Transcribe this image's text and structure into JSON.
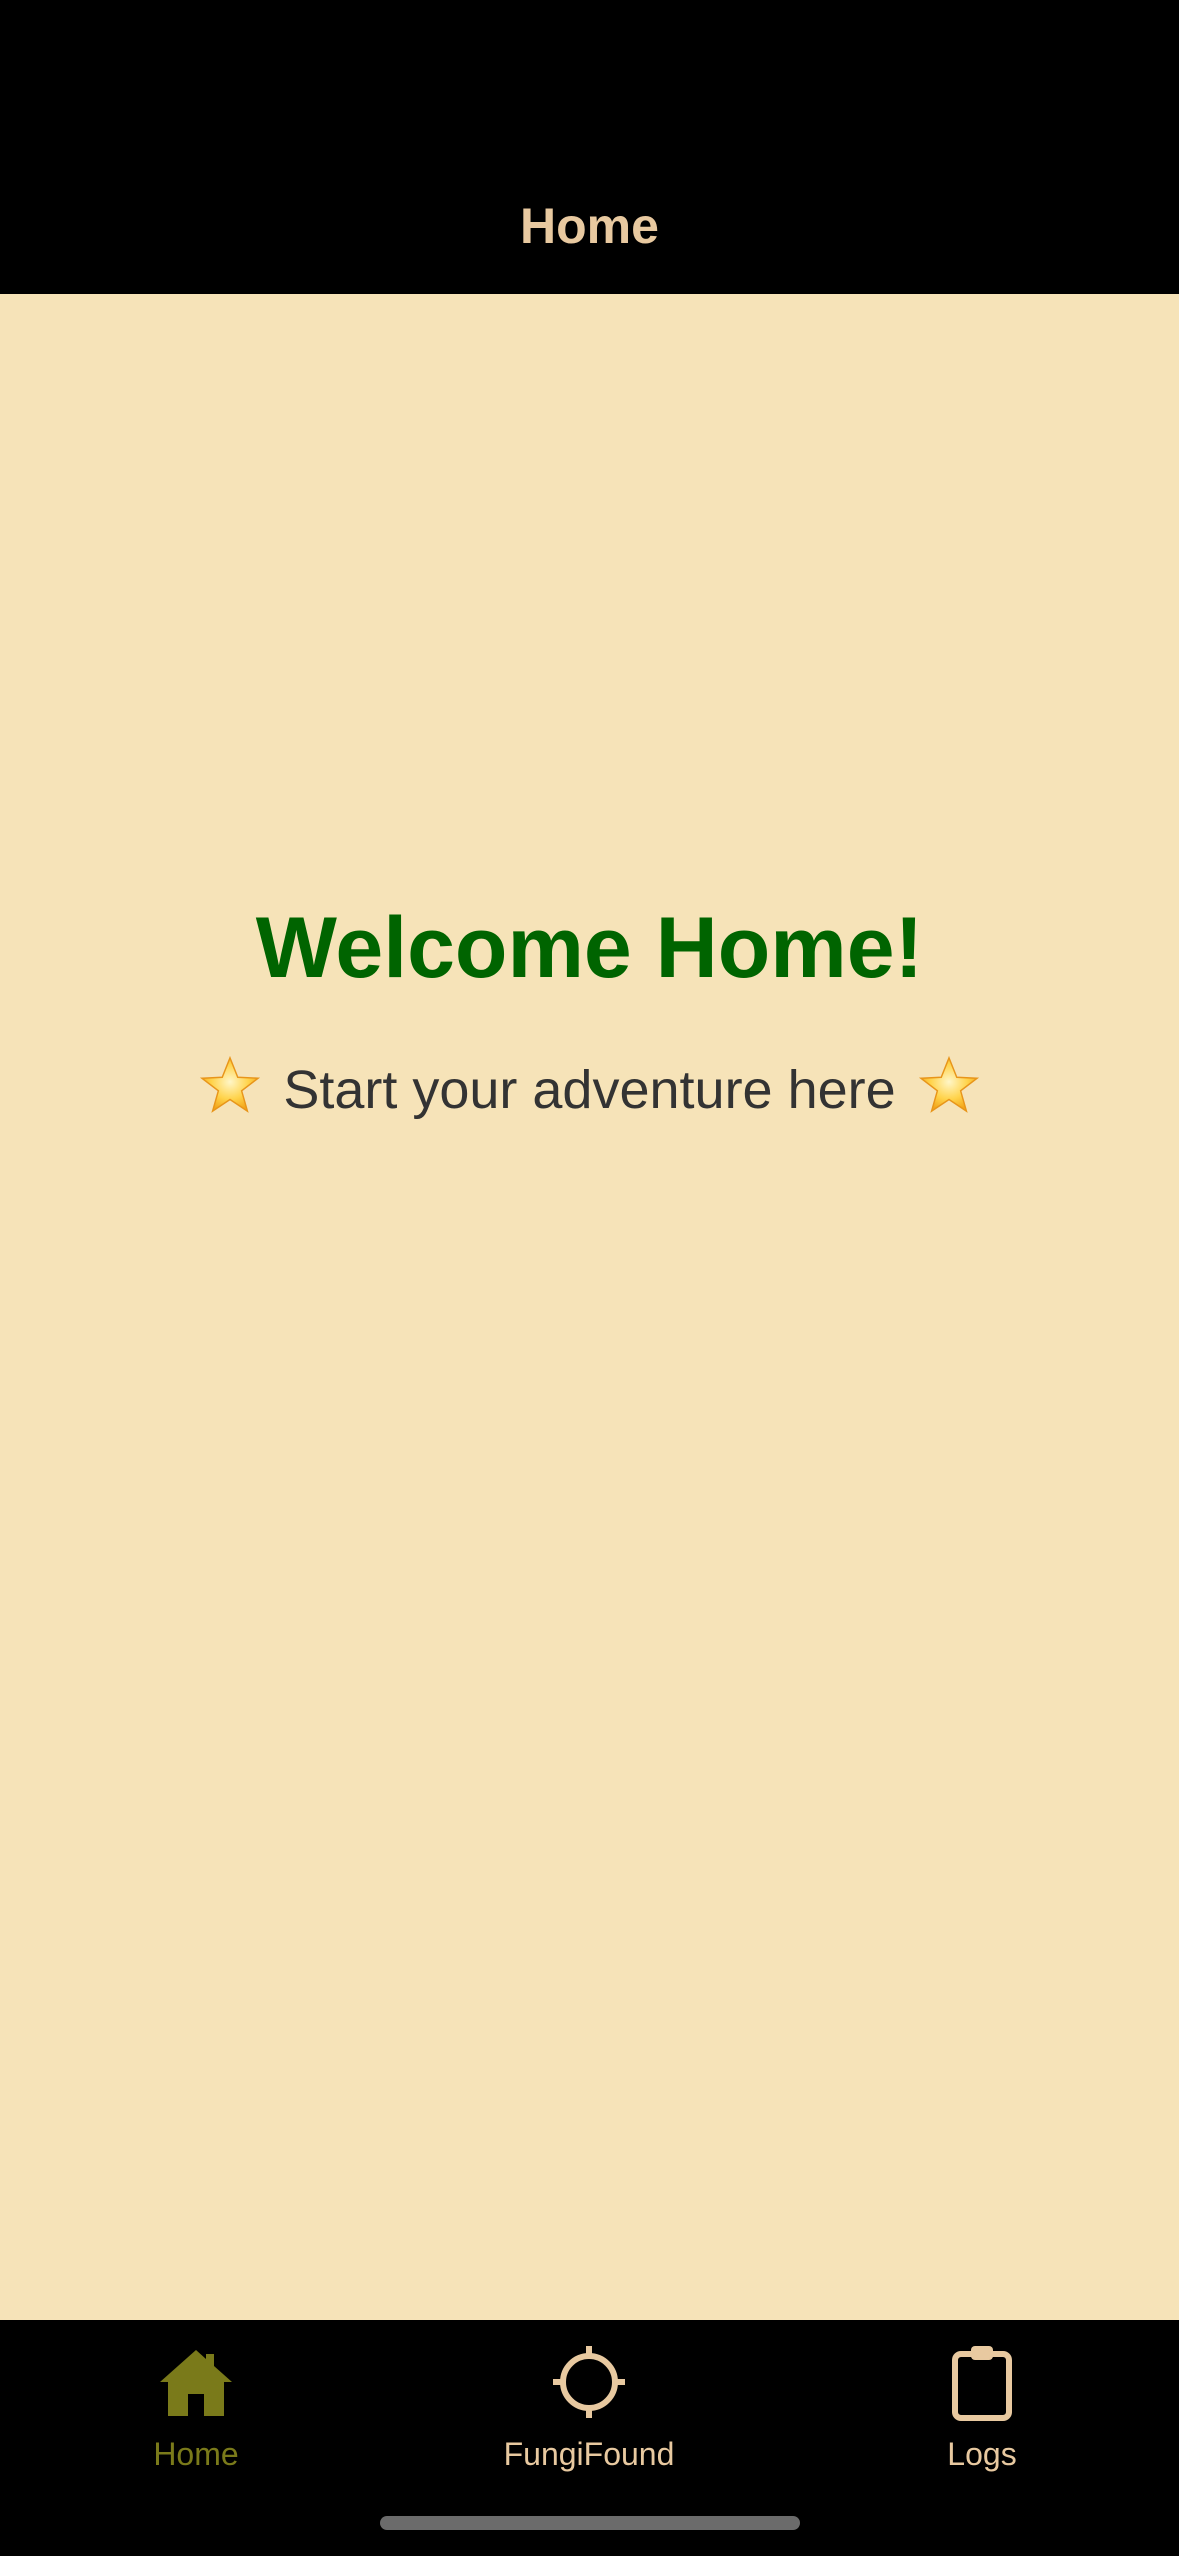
{
  "header": {
    "title": "Home"
  },
  "main": {
    "heading": "Welcome Home!",
    "subtitle": "Start your adventure here",
    "subtitle_icon": "star-icon"
  },
  "tabbar": {
    "tabs": [
      {
        "label": "Home",
        "icon": "house-icon",
        "active": true
      },
      {
        "label": "FungiFound",
        "icon": "crosshair-icon",
        "active": false
      },
      {
        "label": "Logs",
        "icon": "clipboard-icon",
        "active": false
      }
    ]
  },
  "colors": {
    "header_background": "#000000",
    "header_text": "#E8C9A0",
    "content_background": "#F6E3B8",
    "heading": "#006400",
    "subtitle": "#333333",
    "tab_active": "#7A7A1A",
    "tab_inactive": "#E8C9A0"
  }
}
